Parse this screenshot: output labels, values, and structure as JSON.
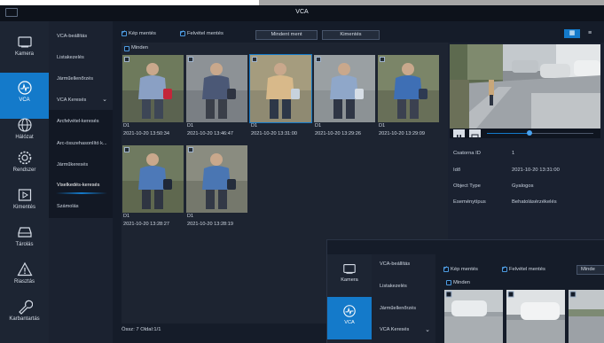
{
  "window": {
    "title": "VCA"
  },
  "nav": {
    "items": [
      {
        "label": "Kamera",
        "icon": "camera-icon"
      },
      {
        "label": "VCA",
        "icon": "vca-icon",
        "active": true
      },
      {
        "label": "Hálózat",
        "icon": "network-icon"
      },
      {
        "label": "Rendszer",
        "icon": "gear-icon"
      },
      {
        "label": "Kimentés",
        "icon": "backup-icon"
      },
      {
        "label": "Tárolás",
        "icon": "storage-icon"
      },
      {
        "label": "Riasztás",
        "icon": "alarm-icon"
      },
      {
        "label": "Karbantartás",
        "icon": "wrench-icon"
      }
    ]
  },
  "submenu": {
    "items": [
      {
        "label": "VCA-beállítás"
      },
      {
        "label": "Listakezelés"
      },
      {
        "label": "Járműellenőrzés"
      },
      {
        "label": "VCA Keresés",
        "expanded": true
      },
      {
        "label": "Arcfelvétel-keresés"
      },
      {
        "label": "Arc-összehasonlító k..."
      },
      {
        "label": "Járműkeresés"
      },
      {
        "label": "Viselkedés-keresés",
        "selected": true
      },
      {
        "label": "Számolás"
      }
    ]
  },
  "toolbar": {
    "image_save_label": "Kép mentés",
    "recording_save_label": "Felvétel mentés",
    "save_all_label": "Mindent ment",
    "export_label": "Kimentés",
    "select_all_label": "Minden"
  },
  "results": [
    {
      "channel": "D1",
      "time": "2021-10-20 13:50:34",
      "colors": [
        "#8aa0c4",
        "#c3263a",
        "#3d4656"
      ]
    },
    {
      "channel": "D1",
      "time": "2021-10-20 13:46:47",
      "colors": [
        "#4b5876",
        "#2e3442",
        "#3a3f49"
      ]
    },
    {
      "channel": "D1",
      "time": "2021-10-20 13:31:00",
      "colors": [
        "#d8b98a",
        "#c7d2dd",
        "#2d3748"
      ],
      "selected": true
    },
    {
      "channel": "D1",
      "time": "2021-10-20 13:29:26",
      "colors": [
        "#8fa7c9",
        "#d7dee6",
        "#2f3645"
      ]
    },
    {
      "channel": "D1",
      "time": "2021-10-20 13:29:09",
      "colors": [
        "#3e6fb5",
        "#2e3a52",
        "#3b4150"
      ]
    },
    {
      "channel": "D1",
      "time": "2021-10-20 13:28:27",
      "colors": [
        "#4d79b8",
        "#1f2838",
        "#2f3542"
      ]
    },
    {
      "channel": "D1",
      "time": "2021-10-20 13:28:19",
      "colors": [
        "#4a76b3",
        "#242d3c",
        "#333946"
      ]
    }
  ],
  "summary": "Össz: 7  Oldal:1/1",
  "detail": {
    "channel_id_label": "Csatorna ID",
    "channel_id_value": "1",
    "time_label": "Idő",
    "time_value": "2021-10-20 13:31:00",
    "object_type_label": "Object Type",
    "object_type_value": "Gyalogos",
    "event_type_label": "Eseménytípus",
    "event_type_value": "Behatolásérzékelés",
    "playback_progress": 0.4
  },
  "overlay": {
    "nav": [
      {
        "label": "Kamera",
        "icon": "camera-icon"
      },
      {
        "label": "VCA",
        "icon": "vca-icon",
        "active": true
      }
    ],
    "submenu": [
      {
        "label": "VCA-beállítás"
      },
      {
        "label": "Listakezelés"
      },
      {
        "label": "Járműellenőrzés"
      },
      {
        "label": "VCA Keresés"
      }
    ],
    "toolbar": {
      "image_save_label": "Kép mentés",
      "recording_save_label": "Felvétel mentés",
      "save_all_label": "Minde",
      "select_all_label": "Minden"
    }
  },
  "colors": {
    "accent": "#147aca",
    "background": "#151c29",
    "sidebar": "#1d2533"
  }
}
